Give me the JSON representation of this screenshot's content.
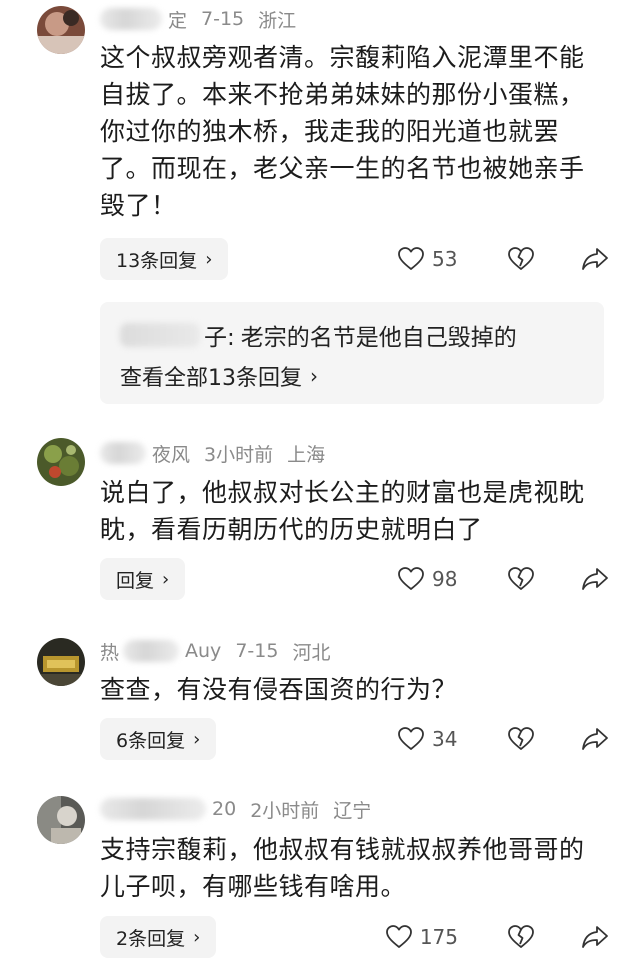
{
  "comments": [
    {
      "name_tail": "定",
      "time": "7-15",
      "location": "浙江",
      "text": "这个叔叔旁观者清。宗馥莉陷入泥潭里不能自拔了。本来不抢弟弟妹妹的那份小蛋糕，你过你的独木桥，我走我的阳光道也就罢了。而现在，老父亲一生的名节也被她亲手毁了！",
      "reply_label": "13条回复",
      "likes": "53",
      "preview": {
        "name_tail": "子:",
        "text": "老宗的名节是他自己毁掉的",
        "view_all": "查看全部13条回复"
      }
    },
    {
      "name_tail": "夜风",
      "time": "3小时前",
      "location": "上海",
      "text": "说白了，他叔叔对长公主的财富也是虎视眈眈，看看历朝历代的历史就明白了",
      "reply_label": "回复",
      "likes": "98"
    },
    {
      "name_head": "热",
      "name_tail": "Auy",
      "time": "7-15",
      "location": "河北",
      "text": "查查，有没有侵吞国资的行为？",
      "reply_label": "6条回复",
      "likes": "34"
    },
    {
      "name_tail": "20",
      "time": "2小时前",
      "location": "辽宁",
      "text": "支持宗馥莉，他叔叔有钱就叔叔养他哥哥的儿子呗，有哪些钱有啥用。",
      "reply_label": "2条回复",
      "likes": "175"
    }
  ],
  "icons": {
    "like": "heart-outline-icon",
    "dislike": "broken-heart-icon",
    "share": "share-arrow-icon",
    "chevron": "chevron-right-icon"
  },
  "colors": {
    "meta": "#8a8a8a",
    "text": "#1c1c1c",
    "button_bg": "#f3f3f3",
    "preview_bg": "#f5f5f5"
  }
}
